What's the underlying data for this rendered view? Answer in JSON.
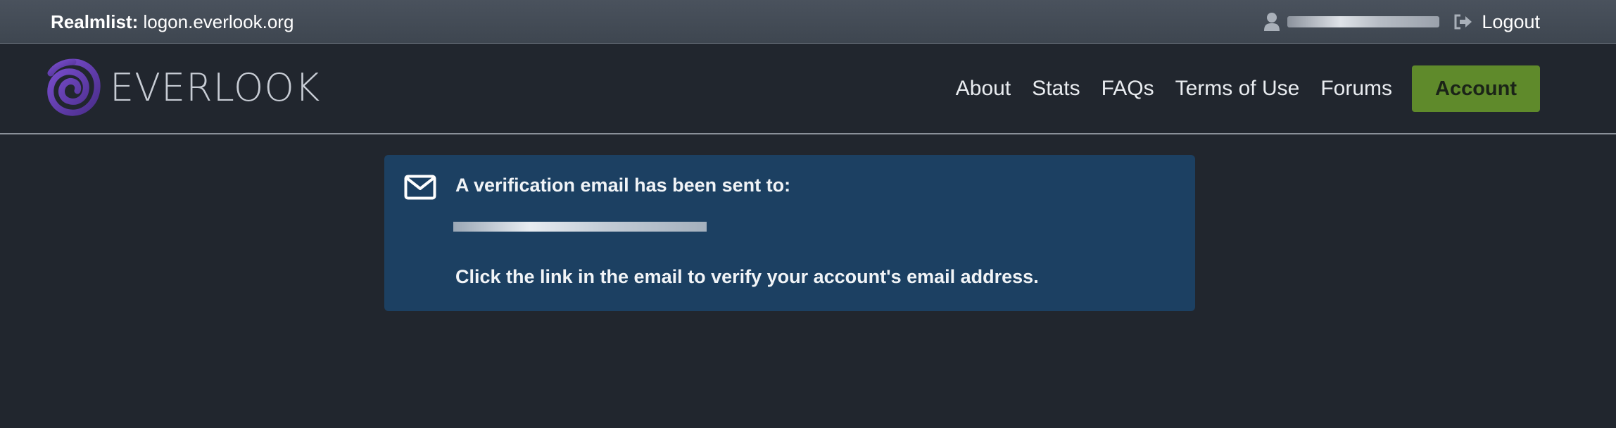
{
  "topbar": {
    "realmlist_label": "Realmlist:",
    "realmlist_value": " logon.everlook.org",
    "user_icon": "user-icon",
    "logout_icon": "sign-out-icon",
    "logout_label": "Logout"
  },
  "navbar": {
    "brand_name": "EVERLOOK",
    "links": [
      {
        "label": "About"
      },
      {
        "label": "Stats"
      },
      {
        "label": "FAQs"
      },
      {
        "label": "Terms of Use"
      },
      {
        "label": "Forums"
      }
    ],
    "account_label": "Account"
  },
  "alert": {
    "icon": "envelope-icon",
    "title": "A verification email has been sent to:",
    "message": "Click the link in the email to verify your account's email address."
  },
  "colors": {
    "page_background": "#21262e",
    "topbar_background": "#444c57",
    "account_button": "#5f8a2b",
    "alert_background": "#1c4062",
    "brand_logo": "#5b3a9e"
  }
}
